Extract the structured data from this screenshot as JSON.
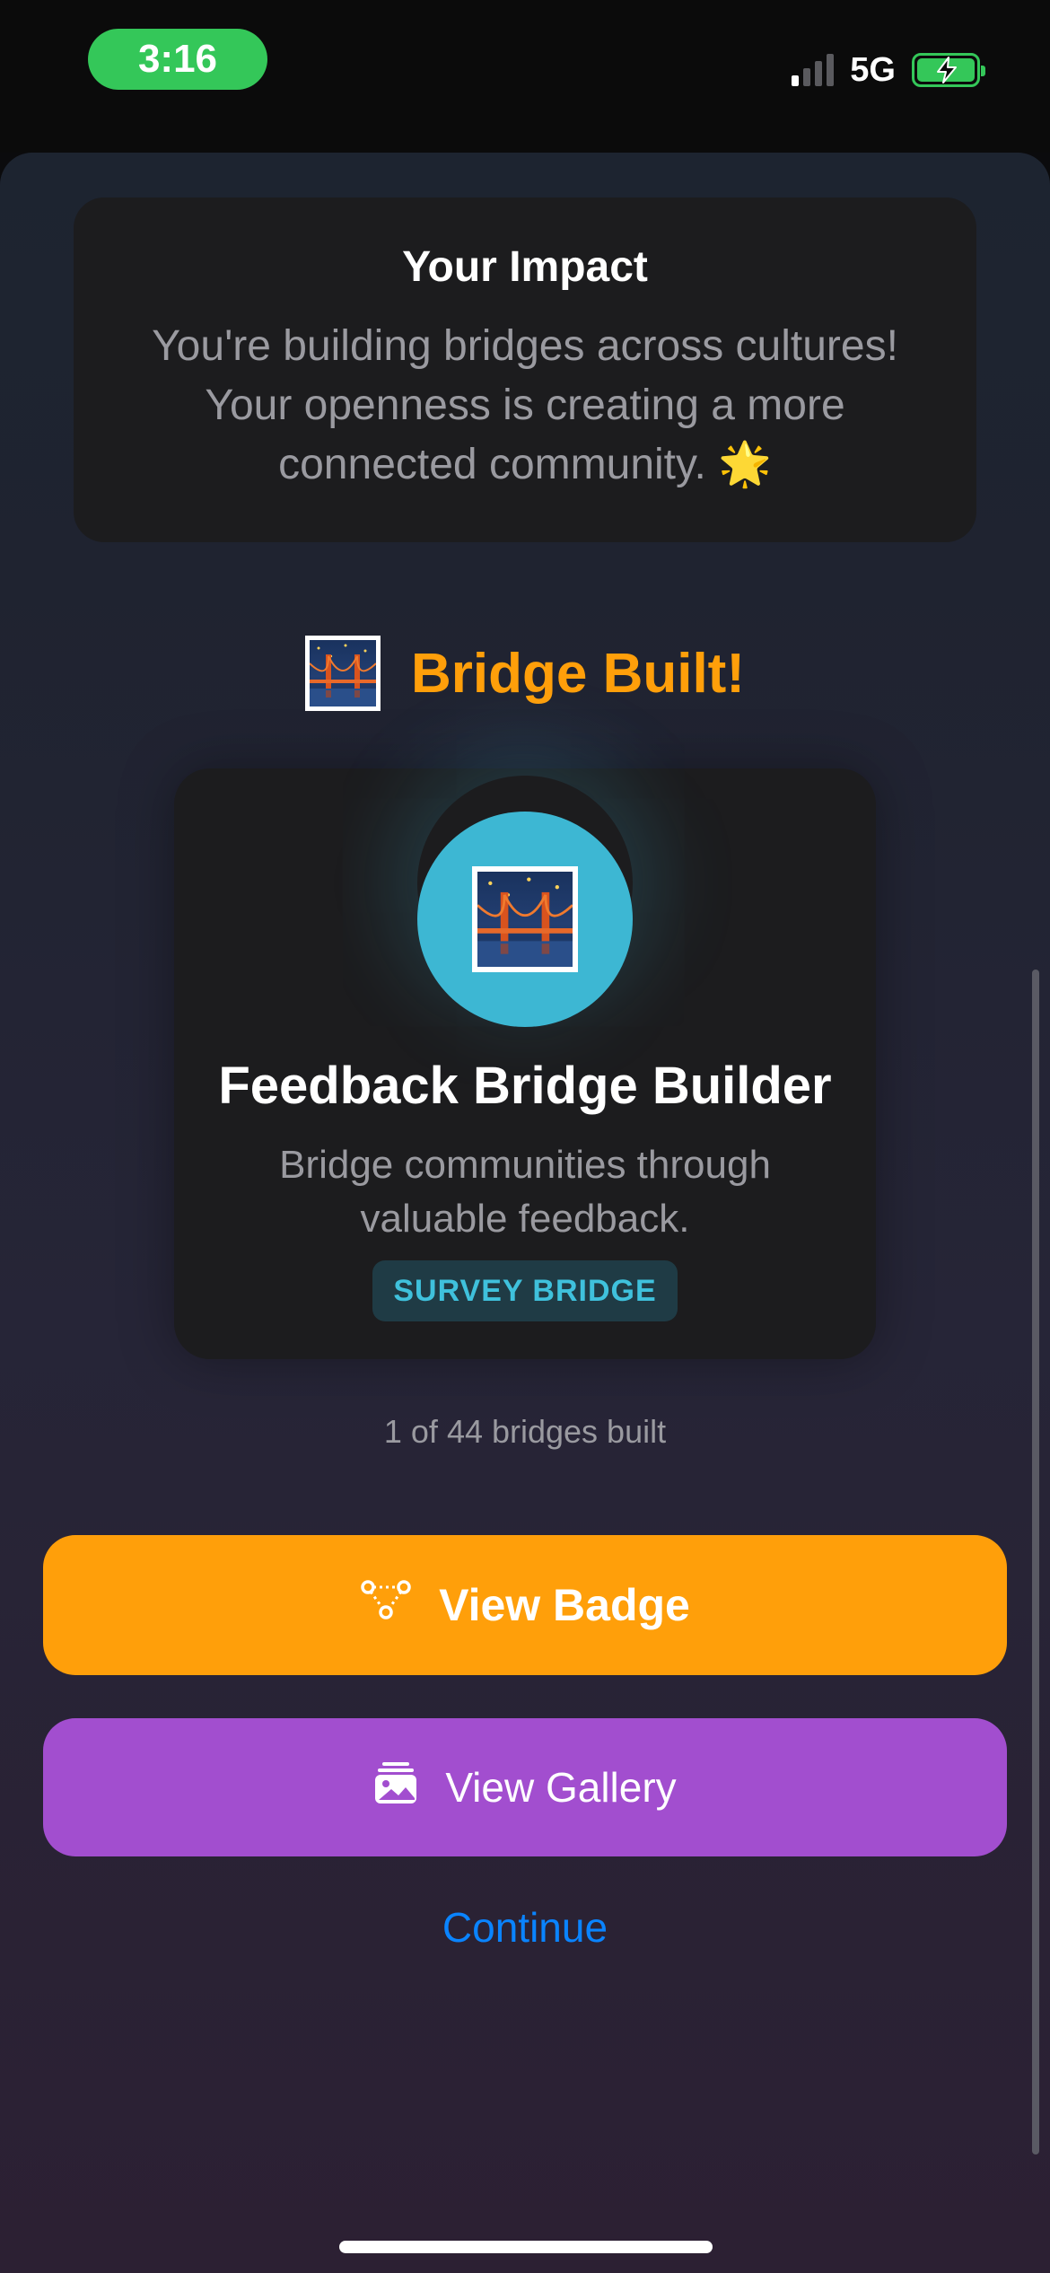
{
  "status_bar": {
    "time": "3:16",
    "network": "5G",
    "signal_bars_active": 1,
    "signal_bars_total": 4,
    "battery_state": "charging",
    "accent_color": "#34c759"
  },
  "impact": {
    "title": "Your Impact",
    "text": "You're building bridges across cultures! Your openness is creating a more connected community. 🌟"
  },
  "achievement": {
    "heading": "Bridge Built!",
    "heading_icon": "bridge-at-night-emoji",
    "heading_color": "#ff9f0a"
  },
  "badge": {
    "icon": "bridge-at-night-emoji",
    "name": "Feedback Bridge Builder",
    "description": "Bridge communities through valuable feedback.",
    "tag": "SURVEY BRIDGE",
    "circle_color": "#3db7d3"
  },
  "progress": {
    "text": "1 of 44 bridges built"
  },
  "actions": {
    "view_badge": {
      "label": "View Badge",
      "icon": "nodes-icon",
      "color": "#ff9f0a"
    },
    "view_gallery": {
      "label": "View Gallery",
      "icon": "gallery-icon",
      "color": "#a24ecf"
    },
    "continue": {
      "label": "Continue",
      "color": "#0a84ff"
    }
  }
}
